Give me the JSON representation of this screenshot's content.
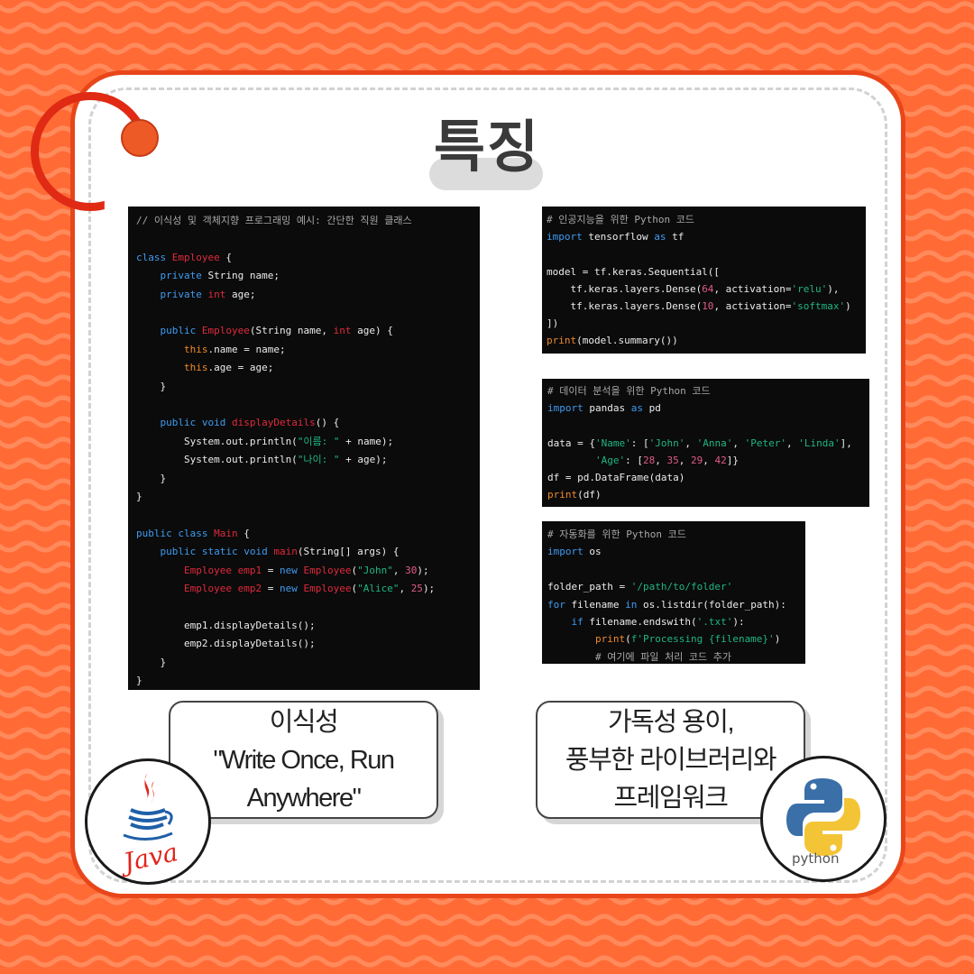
{
  "title": "특징",
  "colors": {
    "background": "#ff6a35",
    "wave": "#ff8a5c",
    "card_border": "#e8461a",
    "code_bg": "#0b0b0b",
    "keyword": "#3f9bf0",
    "type": "#e02a3c",
    "string": "#1fb583",
    "number": "#e05a8a",
    "orange_kw": "#ef8a2c",
    "comment": "#a8a8a8"
  },
  "java_code": {
    "lines": [
      [
        {
          "t": "// 이식성 및 객체지향 프로그래밍 예시: 간단한 직원 클래스",
          "c": "cm"
        }
      ],
      [],
      [
        {
          "t": "class ",
          "c": "kw"
        },
        {
          "t": "Employee",
          "c": "ty"
        },
        {
          "t": " {",
          "c": "pl"
        }
      ],
      [
        {
          "t": "    ",
          "c": "pl"
        },
        {
          "t": "private",
          "c": "kw"
        },
        {
          "t": " String name;",
          "c": "pl"
        }
      ],
      [
        {
          "t": "    ",
          "c": "pl"
        },
        {
          "t": "private",
          "c": "kw"
        },
        {
          "t": " ",
          "c": "pl"
        },
        {
          "t": "int",
          "c": "ty"
        },
        {
          "t": " age;",
          "c": "pl"
        }
      ],
      [],
      [
        {
          "t": "    ",
          "c": "pl"
        },
        {
          "t": "public",
          "c": "kw"
        },
        {
          "t": " ",
          "c": "pl"
        },
        {
          "t": "Employee",
          "c": "ty"
        },
        {
          "t": "(String name, ",
          "c": "pl"
        },
        {
          "t": "int",
          "c": "ty"
        },
        {
          "t": " age) {",
          "c": "pl"
        }
      ],
      [
        {
          "t": "        ",
          "c": "pl"
        },
        {
          "t": "this",
          "c": "or"
        },
        {
          "t": ".name = name;",
          "c": "pl"
        }
      ],
      [
        {
          "t": "        ",
          "c": "pl"
        },
        {
          "t": "this",
          "c": "or"
        },
        {
          "t": ".age = age;",
          "c": "pl"
        }
      ],
      [
        {
          "t": "    }",
          "c": "pl"
        }
      ],
      [],
      [
        {
          "t": "    ",
          "c": "pl"
        },
        {
          "t": "public",
          "c": "kw"
        },
        {
          "t": " ",
          "c": "pl"
        },
        {
          "t": "void",
          "c": "kw"
        },
        {
          "t": " ",
          "c": "pl"
        },
        {
          "t": "displayDetails",
          "c": "ty"
        },
        {
          "t": "() {",
          "c": "pl"
        }
      ],
      [
        {
          "t": "        System.out.println(",
          "c": "pl"
        },
        {
          "t": "\"이름: \"",
          "c": "st"
        },
        {
          "t": " + name);",
          "c": "pl"
        }
      ],
      [
        {
          "t": "        System.out.println(",
          "c": "pl"
        },
        {
          "t": "\"나이: \"",
          "c": "st"
        },
        {
          "t": " + age);",
          "c": "pl"
        }
      ],
      [
        {
          "t": "    }",
          "c": "pl"
        }
      ],
      [
        {
          "t": "}",
          "c": "pl"
        }
      ],
      [],
      [
        {
          "t": "public",
          "c": "kw"
        },
        {
          "t": " ",
          "c": "pl"
        },
        {
          "t": "class",
          "c": "kw"
        },
        {
          "t": " ",
          "c": "pl"
        },
        {
          "t": "Main",
          "c": "ty"
        },
        {
          "t": " {",
          "c": "pl"
        }
      ],
      [
        {
          "t": "    ",
          "c": "pl"
        },
        {
          "t": "public",
          "c": "kw"
        },
        {
          "t": " ",
          "c": "pl"
        },
        {
          "t": "static",
          "c": "kw"
        },
        {
          "t": " ",
          "c": "pl"
        },
        {
          "t": "void",
          "c": "kw"
        },
        {
          "t": " ",
          "c": "pl"
        },
        {
          "t": "main",
          "c": "ty"
        },
        {
          "t": "(String[] args) {",
          "c": "pl"
        }
      ],
      [
        {
          "t": "        ",
          "c": "pl"
        },
        {
          "t": "Employee",
          "c": "ty"
        },
        {
          "t": " ",
          "c": "pl"
        },
        {
          "t": "emp1",
          "c": "ty"
        },
        {
          "t": " = ",
          "c": "pl"
        },
        {
          "t": "new",
          "c": "kw"
        },
        {
          "t": " ",
          "c": "pl"
        },
        {
          "t": "Employee",
          "c": "ty"
        },
        {
          "t": "(",
          "c": "pl"
        },
        {
          "t": "\"John\"",
          "c": "st"
        },
        {
          "t": ", ",
          "c": "pl"
        },
        {
          "t": "30",
          "c": "nu"
        },
        {
          "t": ");",
          "c": "pl"
        }
      ],
      [
        {
          "t": "        ",
          "c": "pl"
        },
        {
          "t": "Employee",
          "c": "ty"
        },
        {
          "t": " ",
          "c": "pl"
        },
        {
          "t": "emp2",
          "c": "ty"
        },
        {
          "t": " = ",
          "c": "pl"
        },
        {
          "t": "new",
          "c": "kw"
        },
        {
          "t": " ",
          "c": "pl"
        },
        {
          "t": "Employee",
          "c": "ty"
        },
        {
          "t": "(",
          "c": "pl"
        },
        {
          "t": "\"Alice\"",
          "c": "st"
        },
        {
          "t": ", ",
          "c": "pl"
        },
        {
          "t": "25",
          "c": "nu"
        },
        {
          "t": ");",
          "c": "pl"
        }
      ],
      [],
      [
        {
          "t": "        emp1.displayDetails();",
          "c": "pl"
        }
      ],
      [
        {
          "t": "        emp2.displayDetails();",
          "c": "pl"
        }
      ],
      [
        {
          "t": "    }",
          "c": "pl"
        }
      ],
      [
        {
          "t": "}",
          "c": "pl"
        }
      ]
    ]
  },
  "python_ai_code": {
    "lines": [
      [
        {
          "t": "# 인공지능을 위한 Python 코드",
          "c": "cm"
        }
      ],
      [
        {
          "t": "import",
          "c": "kw"
        },
        {
          "t": " tensorflow ",
          "c": "pl"
        },
        {
          "t": "as",
          "c": "kw"
        },
        {
          "t": " tf",
          "c": "pl"
        }
      ],
      [],
      [
        {
          "t": "model = tf.keras.Sequential([",
          "c": "pl"
        }
      ],
      [
        {
          "t": "    tf.keras.layers.Dense(",
          "c": "pl"
        },
        {
          "t": "64",
          "c": "nu"
        },
        {
          "t": ", activation=",
          "c": "pl"
        },
        {
          "t": "'relu'",
          "c": "st"
        },
        {
          "t": "),",
          "c": "pl"
        }
      ],
      [
        {
          "t": "    tf.keras.layers.Dense(",
          "c": "pl"
        },
        {
          "t": "10",
          "c": "nu"
        },
        {
          "t": ", activation=",
          "c": "pl"
        },
        {
          "t": "'softmax'",
          "c": "st"
        },
        {
          "t": ")",
          "c": "pl"
        }
      ],
      [
        {
          "t": "])",
          "c": "pl"
        }
      ],
      [
        {
          "t": "print",
          "c": "or"
        },
        {
          "t": "(model.summary())",
          "c": "pl"
        }
      ]
    ]
  },
  "python_data_code": {
    "lines": [
      [
        {
          "t": "# 데이터 분석을 위한 Python 코드",
          "c": "cm"
        }
      ],
      [
        {
          "t": "import",
          "c": "kw"
        },
        {
          "t": " pandas ",
          "c": "pl"
        },
        {
          "t": "as",
          "c": "kw"
        },
        {
          "t": " pd",
          "c": "pl"
        }
      ],
      [],
      [
        {
          "t": "data = {",
          "c": "pl"
        },
        {
          "t": "'Name'",
          "c": "st"
        },
        {
          "t": ": [",
          "c": "pl"
        },
        {
          "t": "'John'",
          "c": "st"
        },
        {
          "t": ", ",
          "c": "pl"
        },
        {
          "t": "'Anna'",
          "c": "st"
        },
        {
          "t": ", ",
          "c": "pl"
        },
        {
          "t": "'Peter'",
          "c": "st"
        },
        {
          "t": ", ",
          "c": "pl"
        },
        {
          "t": "'Linda'",
          "c": "st"
        },
        {
          "t": "],",
          "c": "pl"
        }
      ],
      [
        {
          "t": "        ",
          "c": "pl"
        },
        {
          "t": "'Age'",
          "c": "st"
        },
        {
          "t": ": [",
          "c": "pl"
        },
        {
          "t": "28",
          "c": "nu"
        },
        {
          "t": ", ",
          "c": "pl"
        },
        {
          "t": "35",
          "c": "nu"
        },
        {
          "t": ", ",
          "c": "pl"
        },
        {
          "t": "29",
          "c": "nu"
        },
        {
          "t": ", ",
          "c": "pl"
        },
        {
          "t": "42",
          "c": "nu"
        },
        {
          "t": "]}",
          "c": "pl"
        }
      ],
      [
        {
          "t": "df = pd.DataFrame(data)",
          "c": "pl"
        }
      ],
      [
        {
          "t": "print",
          "c": "or"
        },
        {
          "t": "(df)",
          "c": "pl"
        }
      ]
    ]
  },
  "python_auto_code": {
    "lines": [
      [
        {
          "t": "# 자동화를 위한 Python 코드",
          "c": "cm"
        }
      ],
      [
        {
          "t": "import",
          "c": "kw"
        },
        {
          "t": " os",
          "c": "pl"
        }
      ],
      [],
      [
        {
          "t": "folder_path = ",
          "c": "pl"
        },
        {
          "t": "'/path/to/folder'",
          "c": "st"
        }
      ],
      [
        {
          "t": "for",
          "c": "kw"
        },
        {
          "t": " filename ",
          "c": "pl"
        },
        {
          "t": "in",
          "c": "kw"
        },
        {
          "t": " os.listdir(folder_path):",
          "c": "pl"
        }
      ],
      [
        {
          "t": "    ",
          "c": "pl"
        },
        {
          "t": "if",
          "c": "kw"
        },
        {
          "t": " filename.endswith(",
          "c": "pl"
        },
        {
          "t": "'.txt'",
          "c": "st"
        },
        {
          "t": "):",
          "c": "pl"
        }
      ],
      [
        {
          "t": "        ",
          "c": "pl"
        },
        {
          "t": "print",
          "c": "or"
        },
        {
          "t": "(",
          "c": "pl"
        },
        {
          "t": "f'Processing {filename}'",
          "c": "st"
        },
        {
          "t": ")",
          "c": "pl"
        }
      ],
      [
        {
          "t": "        # 여기에 파일 처리 코드 추가",
          "c": "cm"
        }
      ]
    ]
  },
  "java_caption": [
    "이식성",
    "\"Write Once, Run",
    "Anywhere\""
  ],
  "python_caption": [
    "가독성 용이,",
    "풍부한 라이브러리와",
    "프레임워크"
  ],
  "java_logo": {
    "icon": "java-logo",
    "wordmark": "Java"
  },
  "python_logo": {
    "icon": "python-logo",
    "wordmark": "python"
  }
}
